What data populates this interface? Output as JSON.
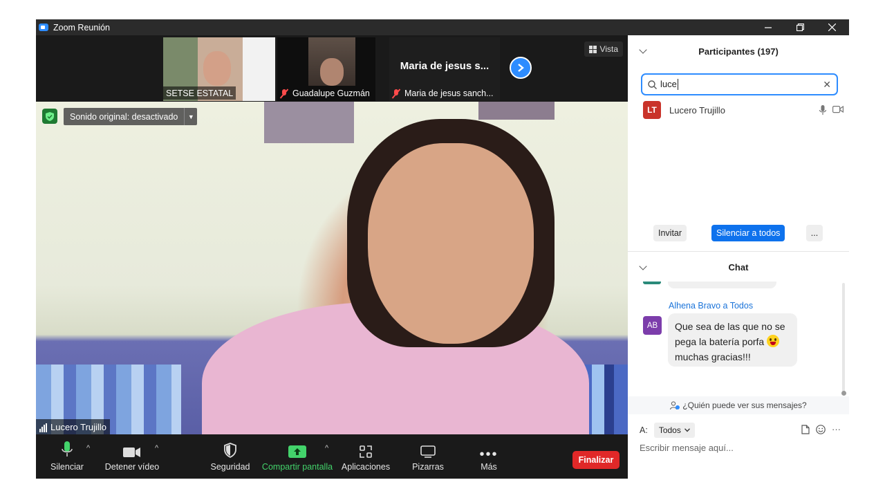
{
  "window": {
    "title": "Zoom Reunión"
  },
  "thumbnails": [
    {
      "name": "SETSE ESTATAL",
      "muted": false
    },
    {
      "name": "Guadalupe Guzmán",
      "muted": true
    },
    {
      "name": "Maria de jesus sanch...",
      "muted": true,
      "title": "Maria de jesus s..."
    }
  ],
  "view_button": {
    "label": "Vista"
  },
  "main_video": {
    "sound_label": "Sonido original: desactivado",
    "speaker_name": "Lucero Trujillo"
  },
  "toolbar": {
    "mute_label": "Silenciar",
    "video_label": "Detener vídeo",
    "security_label": "Seguridad",
    "share_label": "Compartir pantalla",
    "apps_label": "Aplicaciones",
    "whiteboard_label": "Pizarras",
    "more_label": "Más",
    "end_label": "Finalizar"
  },
  "participants": {
    "header": "Participantes (197)",
    "search_value": "luce",
    "list": [
      {
        "initials": "LT",
        "name": "Lucero Trujillo"
      }
    ],
    "invite_label": "Invitar",
    "mute_all_label": "Silenciar a todos",
    "more_label": "..."
  },
  "chat": {
    "header": "Chat",
    "messages": [
      {
        "sender": "Alhena Bravo a Todos",
        "initials": "AB",
        "line1": "Que sea de las que no se",
        "line2": "pega la batería porfa",
        "line3": "muchas gracias!!!"
      }
    ],
    "who_can_see": "¿Quién puede ver sus mensajes?",
    "to_label": "A:",
    "to_value": "Todos",
    "placeholder": "Escribir mensaje aquí..."
  },
  "colors": {
    "accent": "#2d8cff",
    "end": "#e02828",
    "share": "#43d36b",
    "muted": "#ff4b4b"
  }
}
